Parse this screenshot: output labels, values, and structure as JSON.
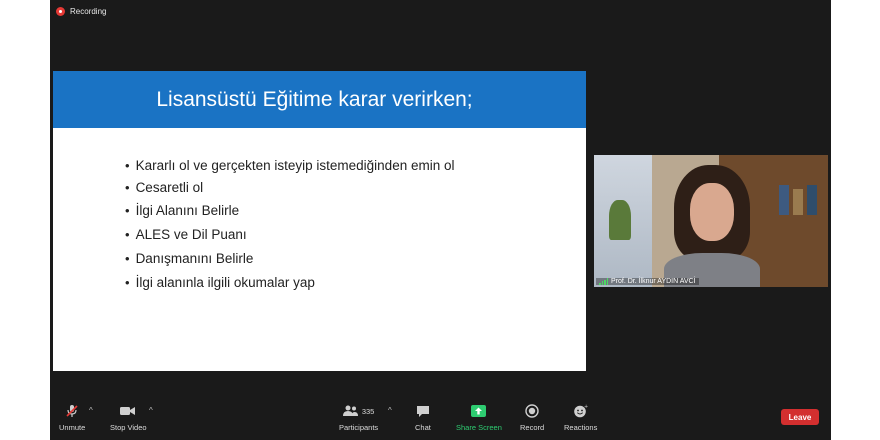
{
  "recording": {
    "label": "Recording"
  },
  "slide": {
    "title": "Lisansüstü Eğitime karar verirken;",
    "bullets": [
      "Kararlı ol ve gerçekten isteyip istemediğinden emin ol",
      "Cesaretli ol",
      "İlgi Alanını Belirle",
      "ALES ve Dil Puanı",
      "Danışmanını Belirle",
      "İlgi alanınla ilgili okumalar yap"
    ]
  },
  "video": {
    "participant_name": "Prof. Dr. İlknur AYDIN AVCİ"
  },
  "toolbar": {
    "unmute": "Unmute",
    "stop_video": "Stop Video",
    "participants_count": "335",
    "participants": "Participants",
    "chat": "Chat",
    "share_screen": "Share Screen",
    "record": "Record",
    "reactions": "Reactions",
    "leave": "Leave"
  },
  "colors": {
    "accent": "#1a73c4",
    "share": "#2ecc71",
    "leave": "#d32f2f"
  }
}
